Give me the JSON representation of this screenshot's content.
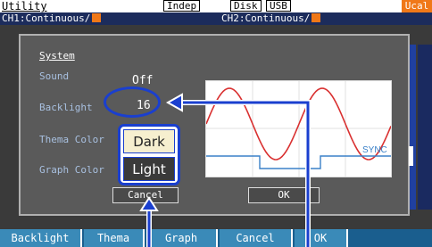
{
  "header": {
    "title": "Utility",
    "indep": "Indep",
    "disk": "Disk",
    "usb": "USB",
    "ucal": "Ucal"
  },
  "channels": {
    "ch1": "CH1:Continuous/",
    "ch2": "CH2:Continuous/"
  },
  "dialog": {
    "title": "System",
    "labels": {
      "sound": "Sound",
      "backlight": "Backlight",
      "thema": "Thema Color",
      "graph": "Graph Color"
    },
    "values": {
      "sound": "Off",
      "backlight": "16"
    },
    "graph_sync": "SYNC",
    "cancel": "Cancel",
    "ok": "OK"
  },
  "dropdown": {
    "options": [
      "Dark",
      "Light"
    ],
    "selected": "Dark"
  },
  "footer": {
    "keys": [
      "Backlight",
      "Thema",
      "Graph",
      "Cancel",
      "OK"
    ]
  },
  "colors": {
    "accent": "#f07818",
    "highlight": "#1a3fcf",
    "wave": "#d93030",
    "sync": "#3a80c8"
  }
}
